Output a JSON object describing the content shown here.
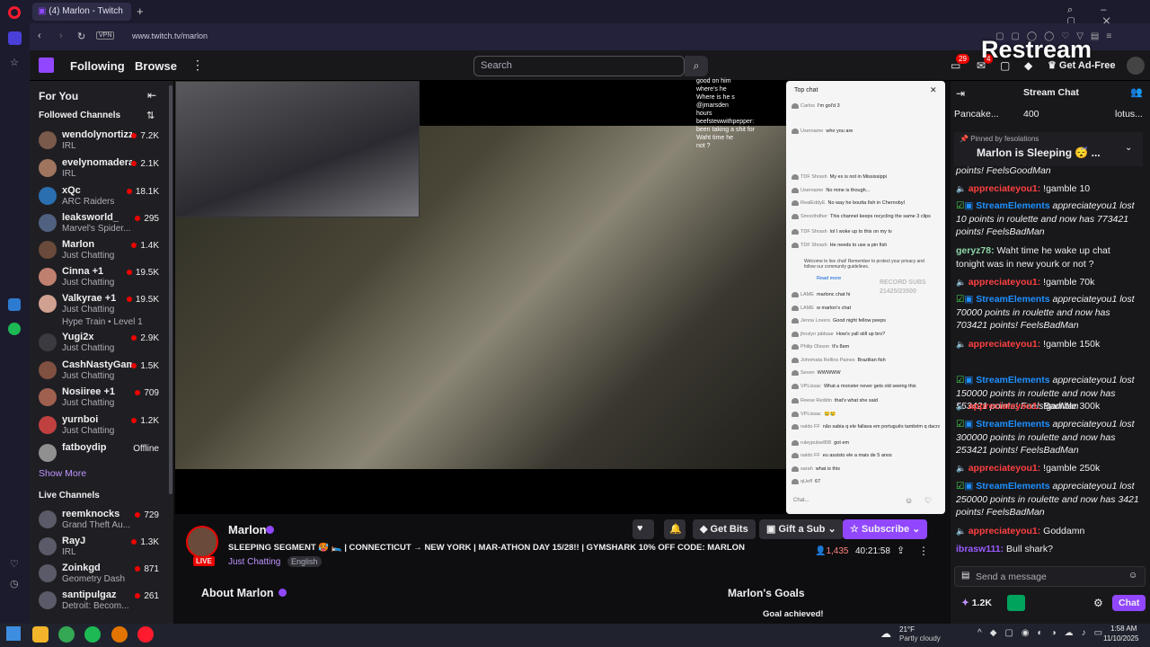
{
  "browser": {
    "tab_title": "(4) Marlon - Twitch",
    "url": "www.twitch.tv/marlon",
    "vpn": "VPN"
  },
  "nav": {
    "following": "Following",
    "browse": "Browse",
    "search_placeholder": "Search",
    "notif_count": "29",
    "inbox_count": "4",
    "get_ad_free": "Get Ad-Free",
    "restream": "Restream"
  },
  "sidebar": {
    "for_you": "For You",
    "followed": "Followed Channels",
    "show_more": "Show More",
    "live_channels": "Live Channels",
    "followed_items": [
      {
        "name": "wendolynortizz",
        "game": "IRL",
        "viewers": "7.2K"
      },
      {
        "name": "evelynomadera",
        "game": "IRL",
        "viewers": "2.1K"
      },
      {
        "name": "xQc",
        "game": "ARC Raiders",
        "viewers": "18.1K"
      },
      {
        "name": "leaksworld_",
        "game": "Marvel's Spider...",
        "viewers": "295"
      },
      {
        "name": "Marlon",
        "game": "Just Chatting",
        "viewers": "1.4K"
      },
      {
        "name": "Cinna +1",
        "game": "Just Chatting",
        "viewers": "19.5K"
      },
      {
        "name": "Valkyrae +1",
        "game": "Just Chatting",
        "viewers": "19.5K"
      },
      {
        "name": "Yugi2x",
        "game": "Just Chatting",
        "viewers": "2.9K"
      },
      {
        "name": "CashNastyGam...",
        "game": "Just Chatting",
        "viewers": "1.5K"
      },
      {
        "name": "Nosiiree +1",
        "game": "Just Chatting",
        "viewers": "709"
      },
      {
        "name": "yurnboi",
        "game": "Just Chatting",
        "viewers": "1.2K"
      },
      {
        "name": "fatboydip",
        "game": "",
        "viewers": "Offline"
      }
    ],
    "hype_train": "Hype Train • Level 1",
    "live_items": [
      {
        "name": "reemknocks",
        "game": "Grand Theft Au...",
        "viewers": "729"
      },
      {
        "name": "RayJ",
        "game": "IRL",
        "viewers": "1.3K"
      },
      {
        "name": "Zoinkgd",
        "game": "Geometry Dash",
        "viewers": "871"
      },
      {
        "name": "santipulgaz",
        "game": "Detroit: Becom...",
        "viewers": "261"
      }
    ]
  },
  "overlay_chat": [
    "good on him",
    "where's he",
    "Where is he s",
    "@jmarsden",
    "hours",
    "beefstewwithpepper:",
    "been taking a shit for",
    "Waht time he",
    "not ?"
  ],
  "yt_chat": {
    "header": "Top chat",
    "pinned_label": "Welcome to live chat! Remember to protect your privacy and follow our community guidelines.",
    "read_more": "Read more",
    "record": "RECORD SUBS",
    "record_count": "21425/23500",
    "input_placeholder": "Chat...",
    "messages": [
      {
        "user": "Carlos",
        "text": "I'm gol'd 3"
      },
      {
        "user": "Username",
        "text": "who you are"
      },
      {
        "user": "TDF Shrash",
        "text": "My ex is not in Mississippi"
      },
      {
        "user": "Username",
        "text": "No mine is though..."
      },
      {
        "user": "RealEddyE",
        "text": "No way he boutta fish in Chernobyl"
      },
      {
        "user": "Smoothdher",
        "text": "This channel keeps recycling the same 3 clips"
      },
      {
        "user": "TDF Shrash",
        "text": "lol I woke up to this on my tv"
      },
      {
        "user": "TDF Shrash",
        "text": "He needs to use a pin fish"
      },
      {
        "user": "LAME",
        "text": "marlonc chat hi"
      },
      {
        "user": "LAME",
        "text": "w marlon's chat"
      },
      {
        "user": "Jenna Lovers",
        "text": "Good night fellow peeps"
      },
      {
        "user": "jhoslyn jabbaar",
        "text": "How's yall still up bro?"
      },
      {
        "user": "Philip Olsson",
        "text": "It's 8am"
      },
      {
        "user": "Johnmata Rellins Paines",
        "text": "Brazilian fish"
      },
      {
        "user": "Seven",
        "text": "WWWWW"
      },
      {
        "user": "VPLissac",
        "text": "What a monster never gets old seeing this"
      },
      {
        "user": "Reese Reddin",
        "text": "that's what she said"
      },
      {
        "user": "VPLissac",
        "text": "😢😢"
      },
      {
        "user": "naldo FF",
        "text": "não sabia q ele fallava em português também q dacra"
      },
      {
        "user": "ruleypulse808",
        "text": "got em"
      },
      {
        "user": "naldo FF",
        "text": "eu assisto ele a mais de 5 anos"
      },
      {
        "user": "sarah",
        "text": "what is this"
      },
      {
        "user": "qUeff",
        "text": "67"
      }
    ]
  },
  "stream": {
    "streamer": "Marlon",
    "title": "SLEEPING SEGMENT 🥵 🛌 | CONNECTICUT → NEW YORK | MAR-ATHON DAY 15/28!! | GYMSHARK 10% OFF CODE: MARLON",
    "category": "Just Chatting",
    "tag": "English",
    "live": "LIVE",
    "viewers": "1,435",
    "uptime": "40:21:58",
    "get_bits": "Get Bits",
    "gift_sub": "Gift a Sub",
    "subscribe": "Subscribe",
    "about": "About Marlon",
    "goals": "Marlon's Goals",
    "goal_achieved": "Goal achieved!"
  },
  "chat": {
    "title": "Stream Chat",
    "gift_leader_1": "Pancake...",
    "gift_leader_count": "400",
    "gift_leader_2": "lotus...",
    "pinned_by": "Pinned by",
    "pinned_user": "fesolations",
    "pinned_msg": "Marlon is Sleeping 😴 ...",
    "input_placeholder": "Send a message",
    "points": "1.2K",
    "chat_button": "Chat",
    "messages": [
      {
        "user": "",
        "text": "points! FeelsGoodMan",
        "kind": "sys"
      },
      {
        "user": "appreciateyou1:",
        "text": "!gamble 10",
        "kind": "red"
      },
      {
        "user": "StreamElements",
        "text": "appreciateyou1 lost 10 points in roulette and now has 773421 points! FeelsBadMan",
        "kind": "blue"
      },
      {
        "user": "geryz78:",
        "text": "Waht time he wake up chat tonight was in new yourk or not ?",
        "kind": "teal"
      },
      {
        "user": "appreciateyou1:",
        "text": "!gamble 70k",
        "kind": "red"
      },
      {
        "user": "StreamElements",
        "text": "appreciateyou1 lost 70000 points in roulette and now has 703421 points! FeelsBadMan",
        "kind": "blue"
      },
      {
        "user": "appreciateyou1:",
        "text": "!gamble 150k",
        "kind": "red"
      },
      {
        "user": "StreamElements",
        "text": "appreciateyou1 lost 150000 points in roulette and now has 553421 points! FeelsBadMan",
        "kind": "blue"
      },
      {
        "user": "appreciateyou1:",
        "text": "!gamble 300k",
        "kind": "red"
      },
      {
        "user": "StreamElements",
        "text": "appreciateyou1 lost 300000 points in roulette and now has 253421 points! FeelsBadMan",
        "kind": "blue"
      },
      {
        "user": "appreciateyou1:",
        "text": "!gamble 250k",
        "kind": "red"
      },
      {
        "user": "StreamElements",
        "text": "appreciateyou1 lost 250000 points in roulette and now has 3421 points! FeelsBadMan",
        "kind": "blue"
      },
      {
        "user": "appreciateyou1:",
        "text": "Goddamn",
        "kind": "red"
      },
      {
        "user": "ibrasw111:",
        "text": "Bull shark?",
        "kind": "purple"
      }
    ]
  },
  "taskbar": {
    "weather_temp": "21°F",
    "weather_desc": "Partly cloudy",
    "time": "1:58 AM",
    "date": "11/10/2025"
  },
  "colors": {
    "twitch_purple": "#9147ff",
    "live_red": "#eb0400",
    "bg": "#0e0e10"
  }
}
